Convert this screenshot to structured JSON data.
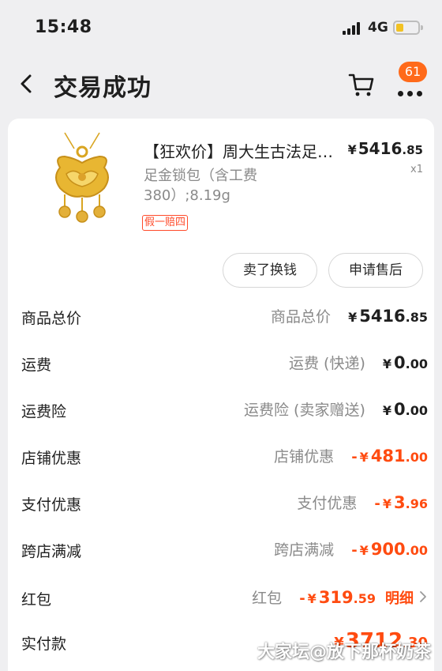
{
  "status_bar": {
    "time": "15:48",
    "network": "4G",
    "battery_level": 0.35
  },
  "nav": {
    "title": "交易成功",
    "badge_count": "61"
  },
  "product": {
    "title": "【狂欢价】周大生古法足金锁包吊坠",
    "sku": "足金锁包（含工费380）;8.19g",
    "tag": "假一赔四",
    "price": {
      "currency": "¥",
      "integer": "5416",
      "decimal": ".85"
    },
    "quantity": "x1"
  },
  "actions": {
    "sell": "卖了换钱",
    "after_sales": "申请售后"
  },
  "fees": [
    {
      "label": "商品总价",
      "desc": "商品总价",
      "currency": "¥",
      "integer": "5416",
      "decimal": ".85"
    },
    {
      "label": "运费",
      "desc": "运费 (快递)",
      "currency": "¥",
      "integer": "0",
      "decimal": ".00"
    },
    {
      "label": "运费险",
      "desc": "运费险 (卖家赠送)",
      "currency": "¥",
      "integer": "0",
      "decimal": ".00"
    },
    {
      "label": "店铺优惠",
      "desc": "店铺优惠",
      "sign": "-",
      "currency": "¥",
      "integer": "481",
      "decimal": ".00"
    },
    {
      "label": "支付优惠",
      "desc": "支付优惠",
      "sign": "-",
      "currency": "¥",
      "integer": "3",
      "decimal": ".96"
    },
    {
      "label": "跨店满减",
      "desc": "跨店满减",
      "sign": "-",
      "currency": "¥",
      "integer": "900",
      "decimal": ".00"
    }
  ],
  "red_packet": {
    "label": "红包",
    "desc": "红包",
    "sign": "-",
    "currency": "¥",
    "integer": "319",
    "decimal": ".59",
    "link": "明细"
  },
  "paid": {
    "label": "实付款",
    "currency": "¥",
    "integer": "3712",
    "decimal": ".30"
  },
  "watermark": "大家坛@放下那杯奶茶",
  "colors": {
    "accent": "#ff4b10",
    "badge": "#ff6a1a",
    "background": "#efeff1"
  }
}
